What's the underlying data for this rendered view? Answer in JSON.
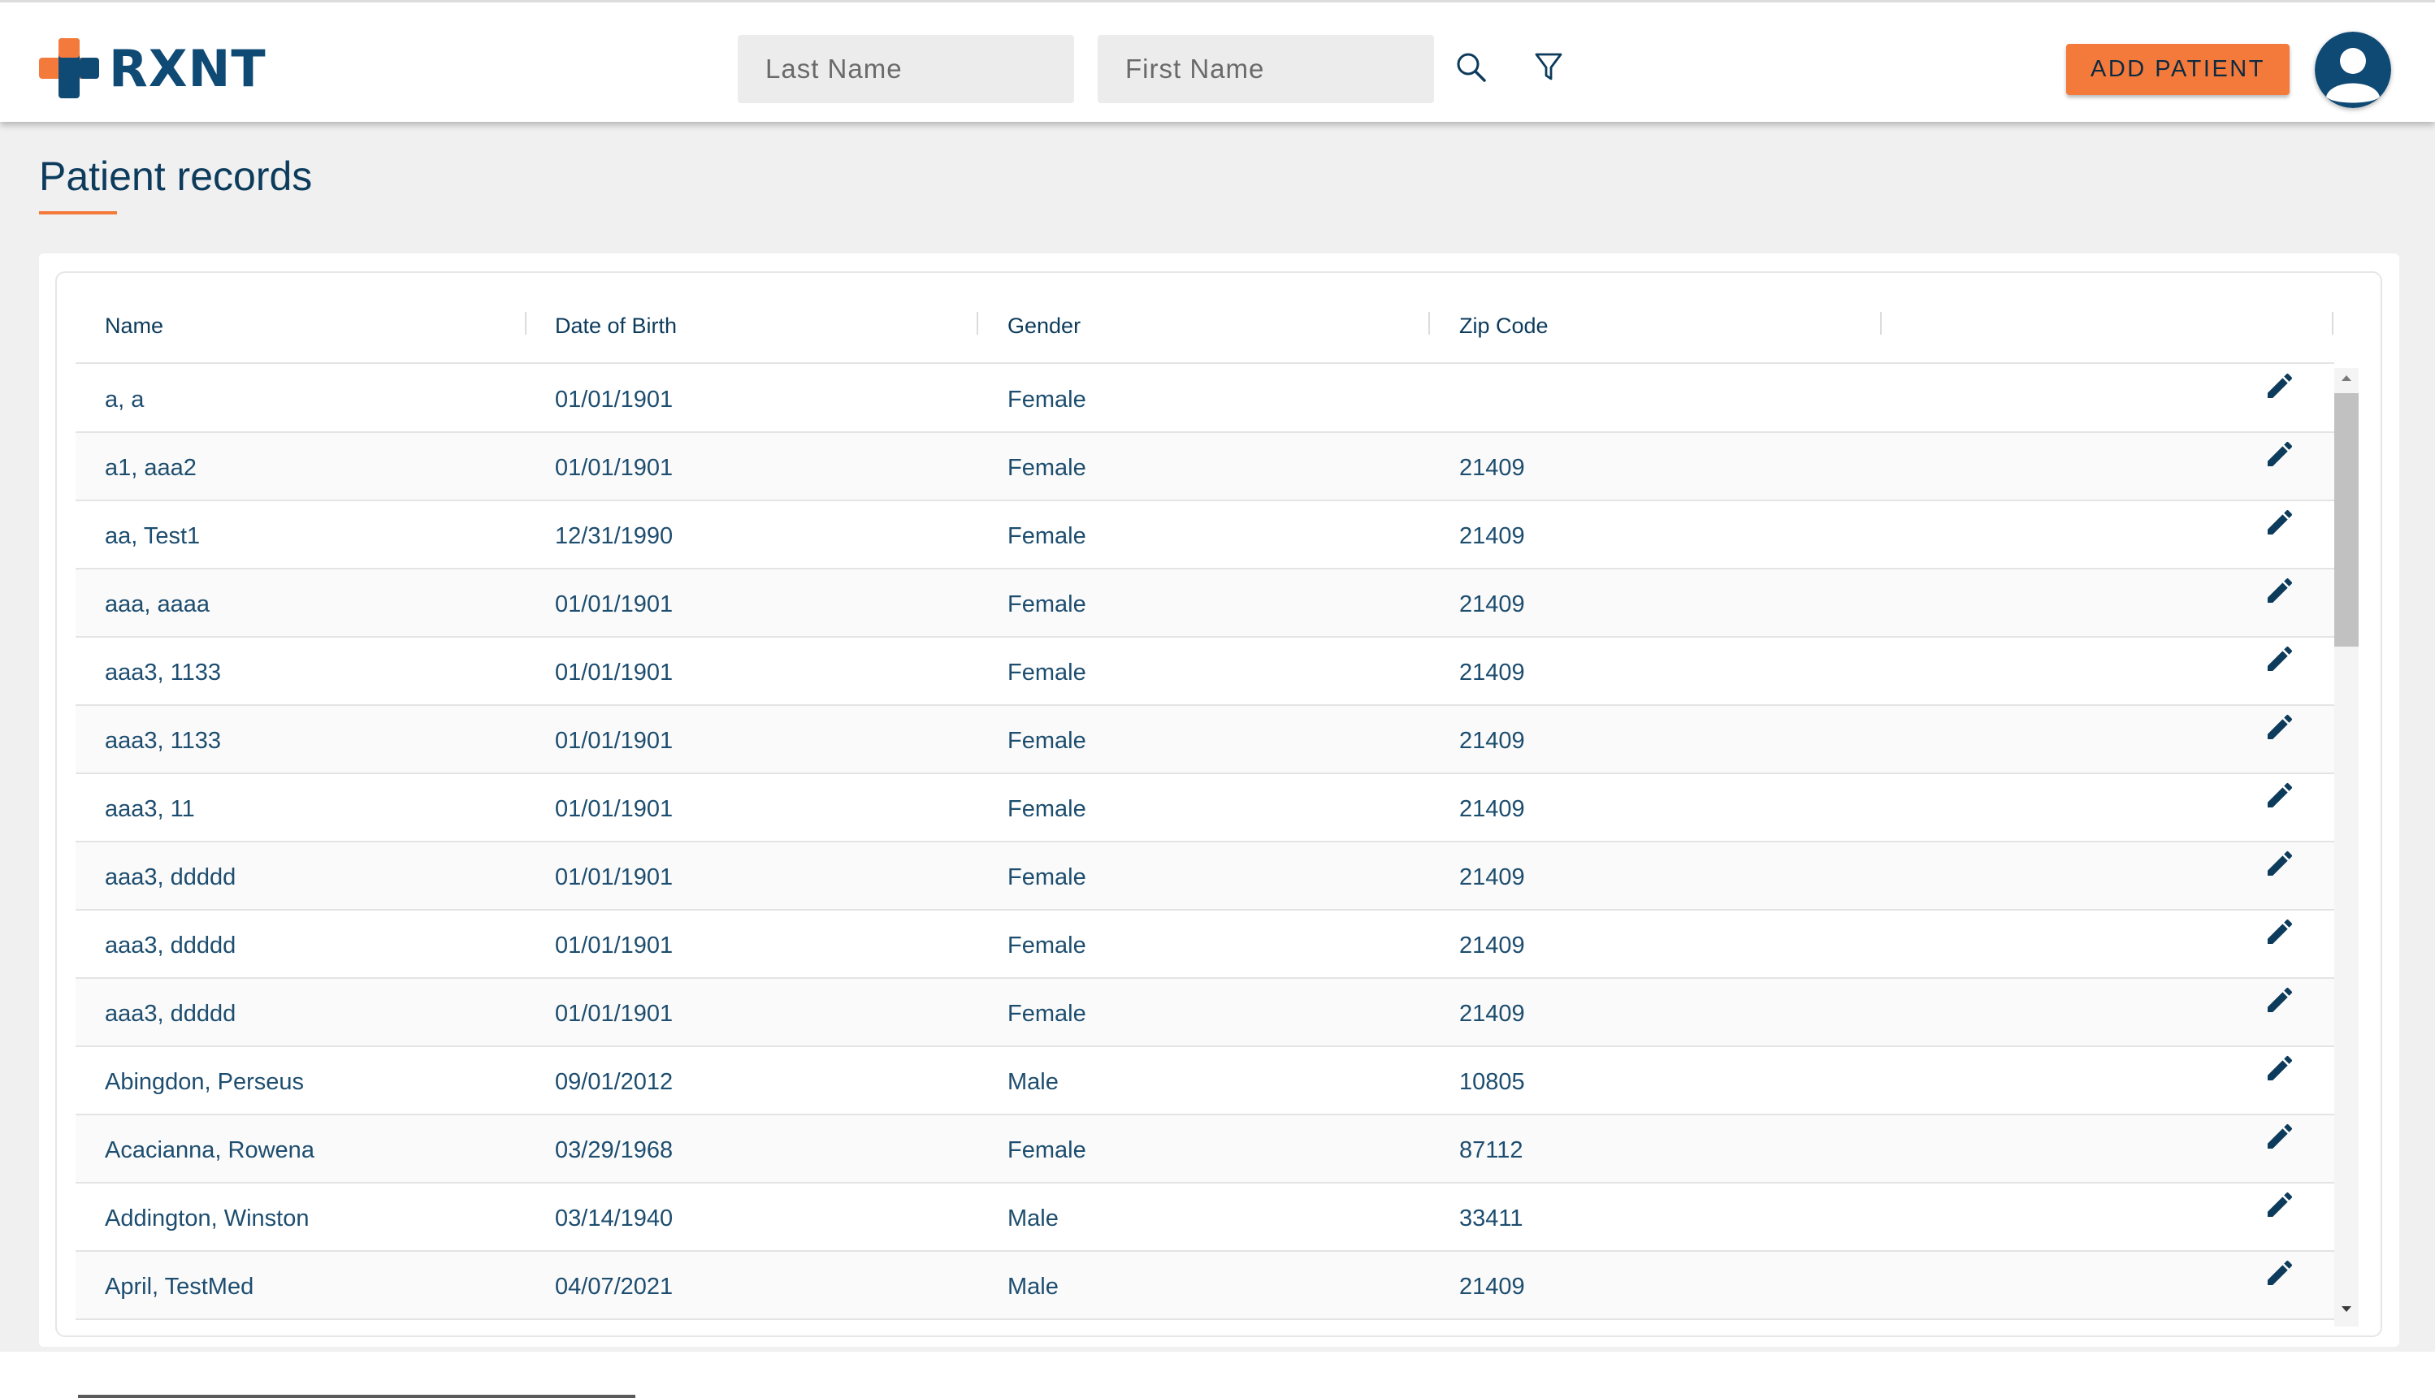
{
  "header": {
    "logo_text": "RXNT",
    "last_name_placeholder": "Last Name",
    "first_name_placeholder": "First Name",
    "search_icon": "search-icon",
    "filter_icon": "filter-icon",
    "add_patient_label": "ADD PATIENT",
    "avatar_icon": "user-avatar-icon"
  },
  "colors": {
    "brand_blue": "#0f4a75",
    "brand_orange": "#f47a3b",
    "text": "#0d3b5c"
  },
  "page": {
    "title": "Patient records"
  },
  "table": {
    "columns": [
      "Name",
      "Date of Birth",
      "Gender",
      "Zip Code"
    ],
    "edit_icon": "pencil-edit-icon",
    "rows": [
      {
        "name": "a, a",
        "dob": "01/01/1901",
        "gender": "Female",
        "zip": ""
      },
      {
        "name": "a1, aaa2",
        "dob": "01/01/1901",
        "gender": "Female",
        "zip": "21409"
      },
      {
        "name": "aa, Test1",
        "dob": "12/31/1990",
        "gender": "Female",
        "zip": "21409"
      },
      {
        "name": "aaa, aaaa",
        "dob": "01/01/1901",
        "gender": "Female",
        "zip": "21409"
      },
      {
        "name": "aaa3, 1133",
        "dob": "01/01/1901",
        "gender": "Female",
        "zip": "21409"
      },
      {
        "name": "aaa3, 1133",
        "dob": "01/01/1901",
        "gender": "Female",
        "zip": "21409"
      },
      {
        "name": "aaa3, 11",
        "dob": "01/01/1901",
        "gender": "Female",
        "zip": "21409"
      },
      {
        "name": "aaa3, ddddd",
        "dob": "01/01/1901",
        "gender": "Female",
        "zip": "21409"
      },
      {
        "name": "aaa3, ddddd",
        "dob": "01/01/1901",
        "gender": "Female",
        "zip": "21409"
      },
      {
        "name": "aaa3, ddddd",
        "dob": "01/01/1901",
        "gender": "Female",
        "zip": "21409"
      },
      {
        "name": "Abingdon, Perseus",
        "dob": "09/01/2012",
        "gender": "Male",
        "zip": "10805"
      },
      {
        "name": "Acacianna, Rowena",
        "dob": "03/29/1968",
        "gender": "Female",
        "zip": "87112"
      },
      {
        "name": "Addington, Winston",
        "dob": "03/14/1940",
        "gender": "Male",
        "zip": "33411"
      },
      {
        "name": "April, TestMed",
        "dob": "04/07/2021",
        "gender": "Male",
        "zip": "21409"
      }
    ]
  }
}
